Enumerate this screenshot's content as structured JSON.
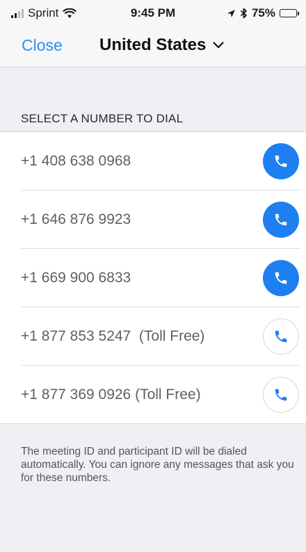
{
  "status_bar": {
    "carrier": "Sprint",
    "time": "9:45 PM",
    "battery": "75%",
    "battery_level": 0.75,
    "icons": [
      "signal-bars-icon",
      "wifi-icon",
      "location-arrow-icon",
      "bluetooth-icon",
      "battery-icon"
    ]
  },
  "nav": {
    "close_label": "Close",
    "country": "United States"
  },
  "section_title": "SELECT A NUMBER TO DIAL",
  "numbers": [
    {
      "number": "+1 408 638 0968",
      "style": "filled"
    },
    {
      "number": "+1 646 876 9923",
      "style": "filled"
    },
    {
      "number": "+1 669 900 6833",
      "style": "filled"
    },
    {
      "number": "+1 877 853 5247  (Toll Free)",
      "style": "outlined"
    },
    {
      "number": "+1 877 369 0926 (Toll Free)",
      "style": "outlined"
    }
  ],
  "footer_note": "The meeting ID and participant ID will be dialed automatically. You can ignore any messages that ask you for these numbers.",
  "colors": {
    "accent": "#1e7ff0",
    "link": "#2b8ff5",
    "background": "#efeff4"
  }
}
